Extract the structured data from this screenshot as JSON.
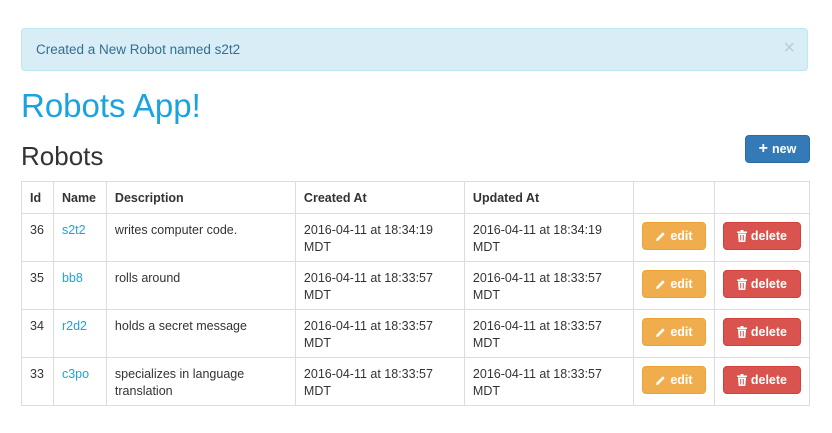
{
  "alert": {
    "message": "Created a New Robot named s2t2",
    "close_glyph": "×"
  },
  "header": {
    "app_title": "Robots App!",
    "section_title": "Robots",
    "new_label": "new"
  },
  "table": {
    "headers": [
      "Id",
      "Name",
      "Description",
      "Created At",
      "Updated At",
      "",
      ""
    ],
    "edit_label": "edit",
    "delete_label": "delete",
    "rows": [
      {
        "id": "36",
        "name": "s2t2",
        "description": "writes computer code.",
        "created": "2016-04-11 at 18:34:19 MDT",
        "updated": "2016-04-11 at 18:34:19 MDT"
      },
      {
        "id": "35",
        "name": "bb8",
        "description": "rolls around",
        "created": "2016-04-11 at 18:33:57 MDT",
        "updated": "2016-04-11 at 18:33:57 MDT"
      },
      {
        "id": "34",
        "name": "r2d2",
        "description": "holds a secret message",
        "created": "2016-04-11 at 18:33:57 MDT",
        "updated": "2016-04-11 at 18:33:57 MDT"
      },
      {
        "id": "33",
        "name": "c3po",
        "description": "specializes in language translation",
        "created": "2016-04-11 at 18:33:57 MDT",
        "updated": "2016-04-11 at 18:33:57 MDT"
      }
    ]
  },
  "colors": {
    "brand": "#1ba3e0",
    "primary": "#337ab7",
    "warning": "#f0ad4e",
    "danger": "#d9534f",
    "info_bg": "#d9edf7"
  },
  "icons": {
    "new": "plus-icon",
    "edit": "pencil-icon",
    "delete": "trash-icon",
    "close": "close-icon"
  }
}
